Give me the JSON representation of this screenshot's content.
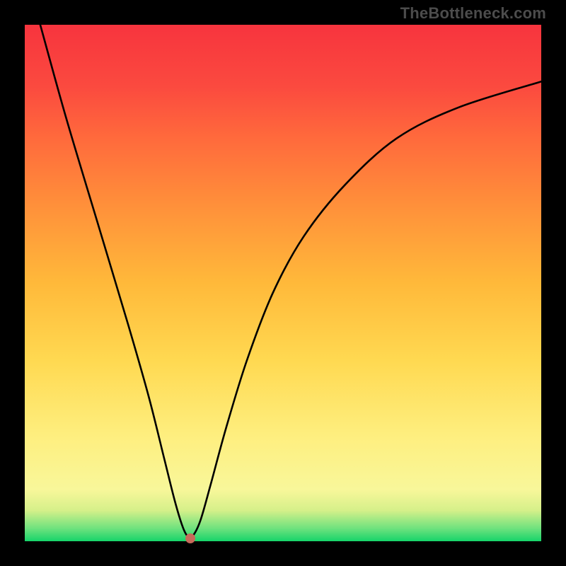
{
  "source_label": "TheBottleneck.com",
  "chart_data": {
    "type": "line",
    "title": "",
    "xlabel": "",
    "ylabel": "",
    "xlim": [
      0,
      100
    ],
    "ylim": [
      0,
      100
    ],
    "series": [
      {
        "name": "curve",
        "x": [
          3,
          8,
          14,
          20,
          24,
          27,
          29,
          30.5,
          31.5,
          32.5,
          34,
          36,
          39,
          43,
          48,
          54,
          62,
          72,
          84,
          100
        ],
        "y": [
          100,
          82,
          62,
          42,
          28,
          16,
          8,
          3,
          1,
          1,
          4,
          11,
          22,
          35,
          48,
          59,
          69,
          78,
          84,
          89
        ]
      }
    ],
    "min_point": {
      "x": 32,
      "y": 0.5
    },
    "gradient_stops": [
      {
        "pct": 0,
        "color": "#16d46a"
      },
      {
        "pct": 2.5,
        "color": "#6fe27e"
      },
      {
        "pct": 6,
        "color": "#d6f08a"
      },
      {
        "pct": 10,
        "color": "#f8f79a"
      },
      {
        "pct": 20,
        "color": "#feef80"
      },
      {
        "pct": 35,
        "color": "#ffd951"
      },
      {
        "pct": 50,
        "color": "#ffb93a"
      },
      {
        "pct": 65,
        "color": "#ff903a"
      },
      {
        "pct": 78,
        "color": "#ff6a3c"
      },
      {
        "pct": 88,
        "color": "#fb4a3f"
      },
      {
        "pct": 100,
        "color": "#f7343e"
      }
    ]
  }
}
